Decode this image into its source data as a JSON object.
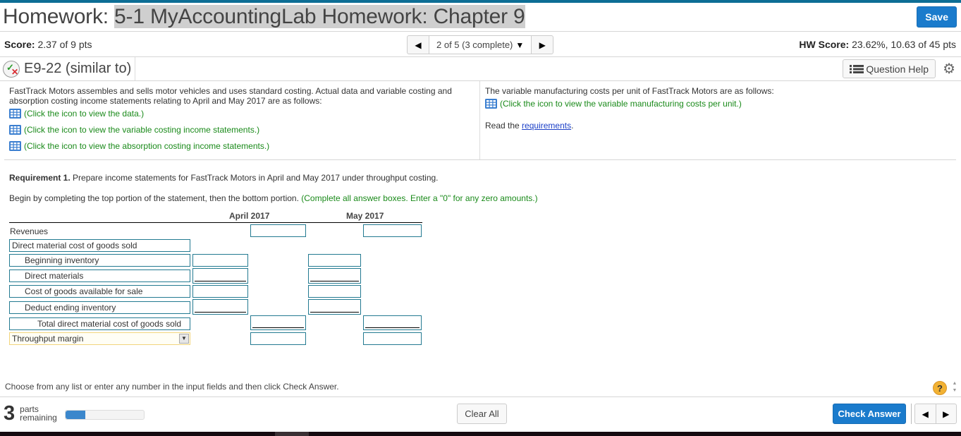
{
  "header": {
    "prefix": "Homework:",
    "title": "5-1 MyAccountingLab Homework: Chapter 9",
    "save_label": "Save"
  },
  "scorebar": {
    "score_label": "Score:",
    "score_value": "2.37 of 9 pts",
    "nav_position": "2 of 5 (3 complete)",
    "hw_score_label": "HW Score:",
    "hw_score_value": "23.62%, 10.63 of 45 pts"
  },
  "question": {
    "name": "E9-22 (similar to)",
    "status_icon": "partial-correct-icon",
    "help_label": "Question Help"
  },
  "problem": {
    "intro": "FastTrack Motors assembles and sells motor vehicles and uses standard costing. Actual data and variable costing and absorption costing income statements relating to April and May 2017 are as follows:",
    "links": [
      "(Click the icon to view the data.)",
      "(Click the icon to view the variable costing income statements.)",
      "(Click the icon to view the absorption costing income statements.)"
    ],
    "right_intro": "The variable manufacturing costs per unit of FastTrack Motors are as follows:",
    "right_link": "(Click the icon to view the variable manufacturing costs per unit.)",
    "read_prefix": "Read the ",
    "read_link": "requirements",
    "read_suffix": "."
  },
  "requirement": {
    "label": "Requirement 1.",
    "text": " Prepare income statements for FastTrack Motors in April and May 2017 under throughput costing.",
    "begin": "Begin by completing the top portion of the statement, then the bottom portion. ",
    "hint": "(Complete all answer boxes. Enter a \"0\" for any zero amounts.)"
  },
  "statement": {
    "columns": [
      "April 2017",
      "May 2017"
    ],
    "rows": [
      {
        "label": "Revenues",
        "type": "static"
      },
      {
        "label": "Direct material cost of goods sold",
        "type": "select"
      },
      {
        "label": "Beginning inventory",
        "type": "select"
      },
      {
        "label": "Direct materials",
        "type": "select"
      },
      {
        "label": "Cost of goods available for sale",
        "type": "select"
      },
      {
        "label": "Deduct ending inventory",
        "type": "select"
      },
      {
        "label": "Total direct material cost of goods sold",
        "type": "select"
      },
      {
        "label": "Throughput margin",
        "type": "dropdown-active"
      }
    ],
    "values": {
      "april": {
        "revenues": "",
        "beginning_inventory": "",
        "direct_materials": "",
        "cost_available": "",
        "ending_inventory": "",
        "total_dm_cogs": "",
        "throughput_margin": ""
      },
      "may": {
        "revenues": "",
        "beginning_inventory": "",
        "direct_materials": "",
        "cost_available": "",
        "ending_inventory": "",
        "total_dm_cogs": "",
        "throughput_margin": ""
      }
    }
  },
  "footer": {
    "instruction": "Choose from any list or enter any number in the input fields and then click Check Answer.",
    "parts_count": "3",
    "parts_label_1": "parts",
    "parts_label_2": "remaining",
    "progress_fraction": 0.25,
    "clear_label": "Clear All",
    "check_label": "Check Answer",
    "help_symbol": "?"
  },
  "colors": {
    "accent": "#1a7bcc",
    "topbar": "#0d6e95",
    "link_green": "#1a8a1a",
    "input_border": "#237a91",
    "title_highlight": "#cfcfcf"
  }
}
